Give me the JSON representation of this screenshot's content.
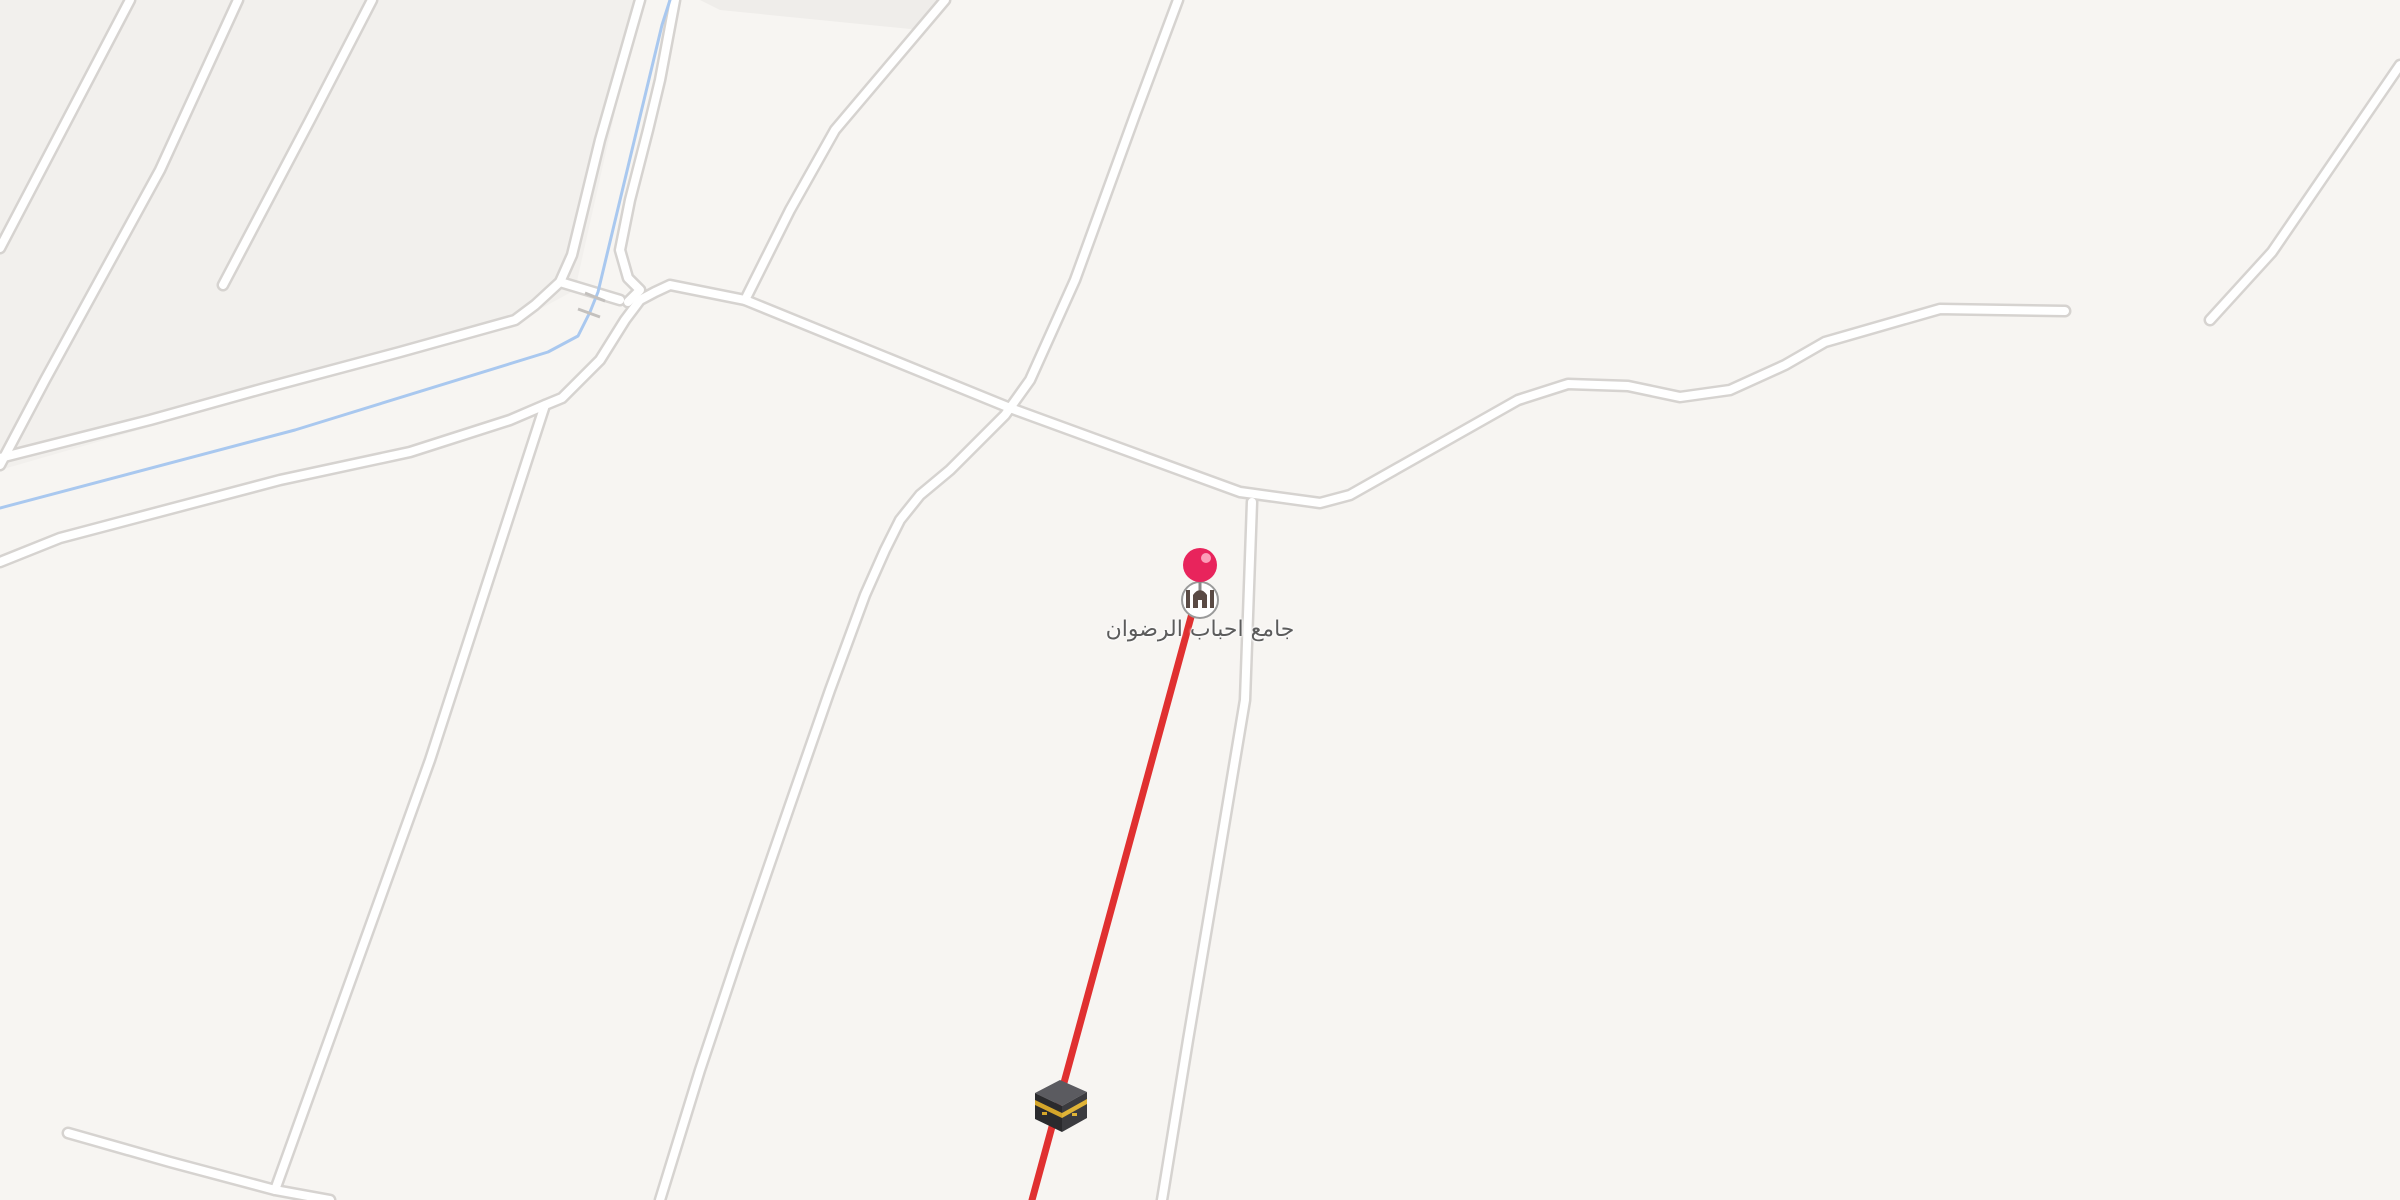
{
  "map": {
    "background_color": "#f7f5f2",
    "road_color": "#ffffff",
    "road_casing_color": "#d6d3d0",
    "water_color": "#a9c8ef"
  },
  "route": {
    "color": "#e03030",
    "description": "qibla direction line"
  },
  "pin": {
    "icon": "map-pin-icon",
    "color": "#e8245c"
  },
  "poi": {
    "icon": "mosque-icon",
    "label": "جامع احباب الرضوان"
  },
  "kaaba_marker": {
    "icon": "kaaba-icon"
  }
}
